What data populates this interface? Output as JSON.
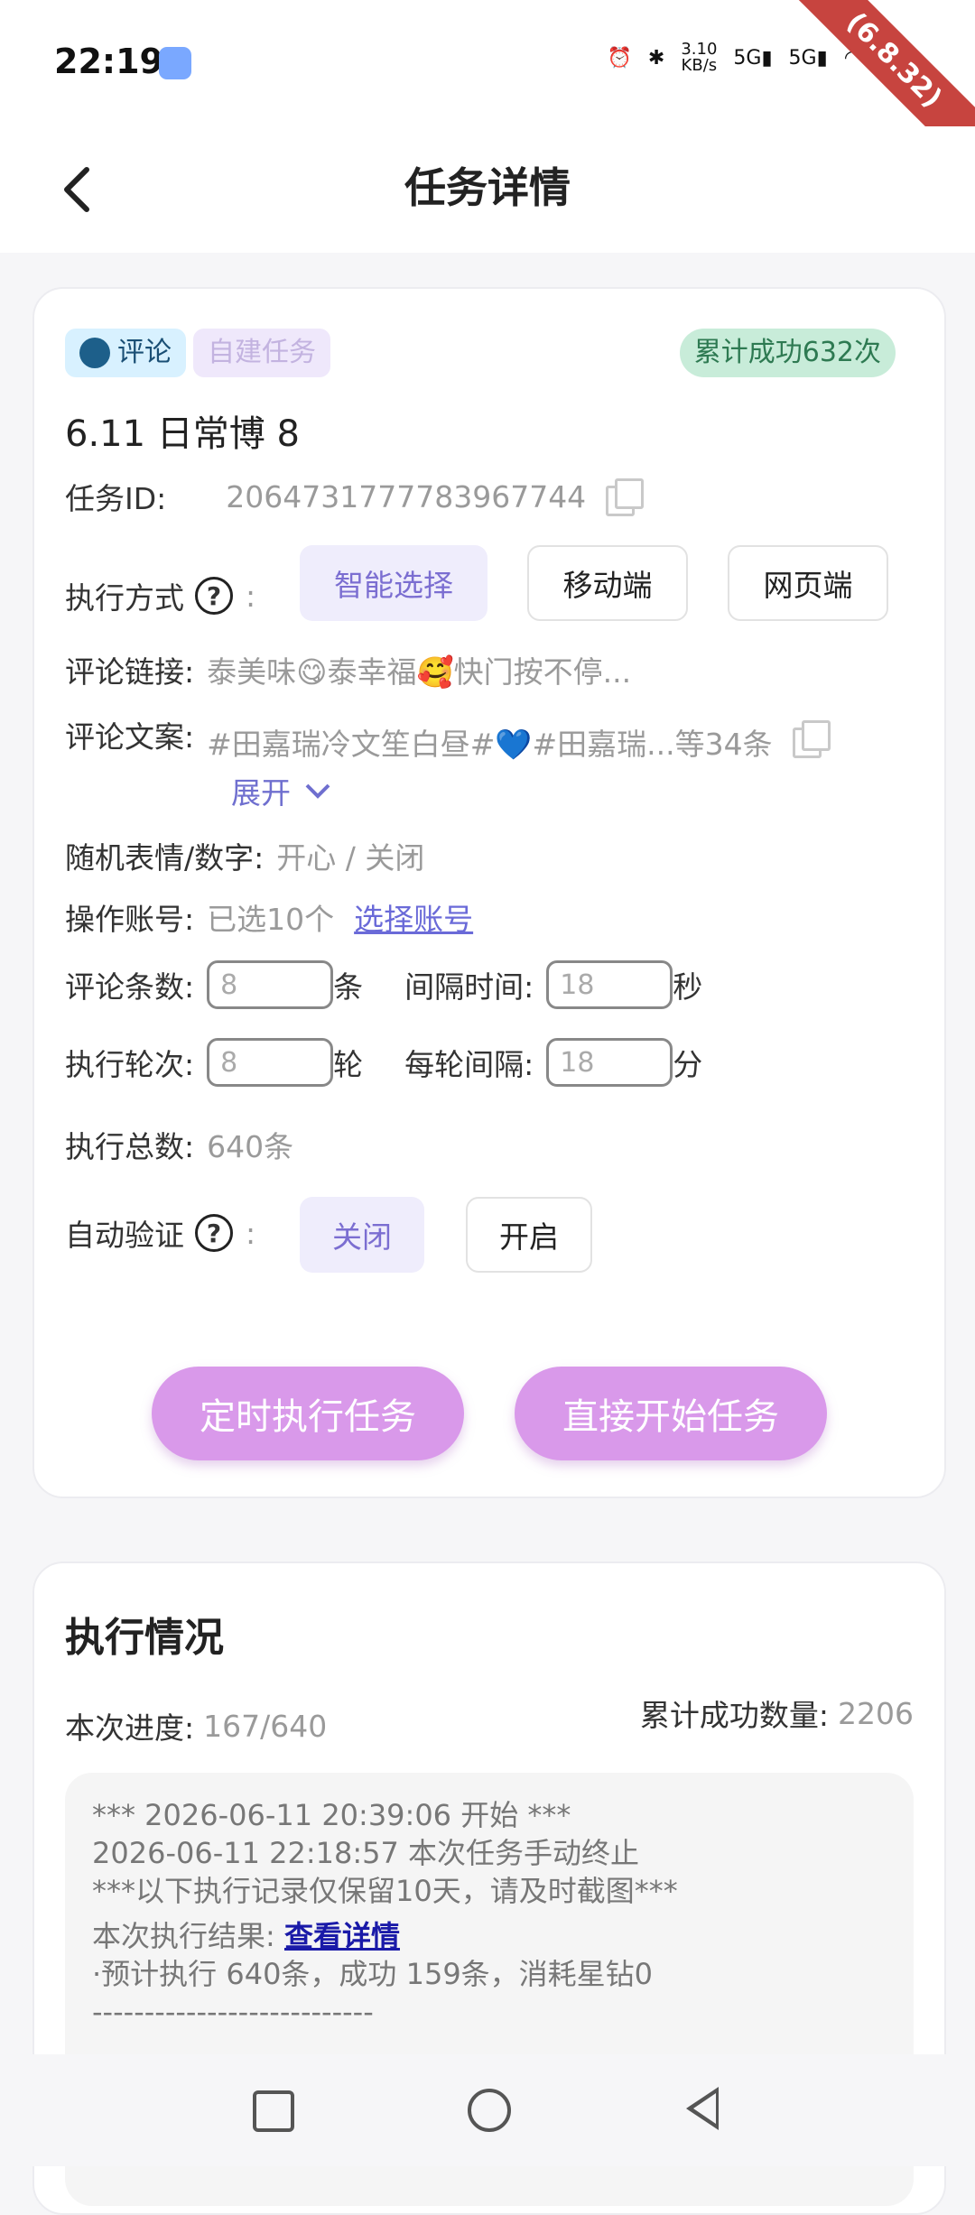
{
  "status": {
    "time": "22:19",
    "speed_top": "3.10",
    "speed_bottom": "KB/s",
    "net1": "5G",
    "net2": "5G",
    "battery": "4",
    "ribbon": "(6.8.32)"
  },
  "header": {
    "title": "任务详情"
  },
  "task": {
    "tags": {
      "type": "评论",
      "self": "自建任务",
      "success": "累计成功632次"
    },
    "name": "6.11  日常博  8",
    "id_label": "任务ID:",
    "id_value": "2064731777783967744",
    "exec_label": "执行方式",
    "exec_colon": ":",
    "exec_modes": [
      "智能选择",
      "移动端",
      "网页端"
    ],
    "link_label": "评论链接:",
    "link_value": "泰美味😋泰幸福🥰快门按不停...",
    "copy_label": "评论文案:",
    "copy_value": "#田嘉瑞冷文笙白昼#💙#田嘉瑞...等34条",
    "expand": "展开",
    "random_label": "随机表情/数字:",
    "random_value": "开心 / 关闭",
    "account_label": "操作账号:",
    "account_value": "已选10个",
    "account_link": "选择账号",
    "count_label": "评论条数:",
    "count_value": "8",
    "count_unit": "条",
    "interval_label": "间隔时间:",
    "interval_value": "18",
    "interval_unit": "秒",
    "rounds_label": "执行轮次:",
    "rounds_value": "8",
    "rounds_unit": "轮",
    "round_interval_label": "每轮间隔:",
    "round_interval_value": "18",
    "round_interval_unit": "分",
    "total_label": "执行总数:",
    "total_value": "640条",
    "auto_label": "自动验证",
    "auto_colon": ":",
    "auto_options": [
      "关闭",
      "开启"
    ],
    "btn_schedule": "定时执行任务",
    "btn_start": "直接开始任务"
  },
  "execution": {
    "title": "执行情况",
    "progress_label": "本次进度:",
    "progress_value": "167/640",
    "total_success_label": "累计成功数量:",
    "total_success_value": "2206",
    "log_lines": [
      "***  2026-06-11 20:39:06 开始  ***",
      "2026-06-11 22:18:57 本次任务手动终止",
      "***以下执行记录仅保留10天，请及时截图***"
    ],
    "result_label": "本次执行结果:",
    "result_link": "查看详情",
    "result_line": "·预计执行 640条，成功 159条，消耗星钻0",
    "divider": "---------------------------"
  }
}
